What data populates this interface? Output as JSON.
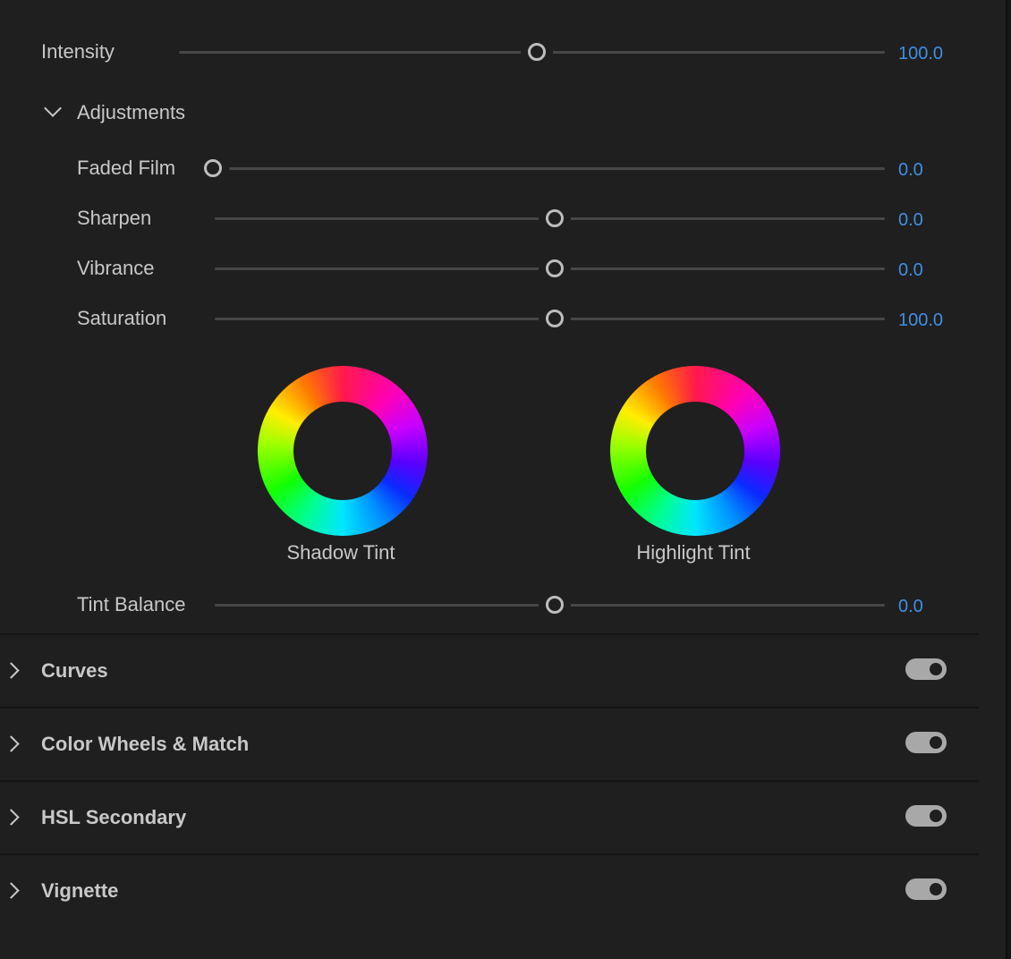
{
  "basic": {
    "intensity": {
      "label": "Intensity",
      "value": "100.0",
      "fraction": 0.5
    }
  },
  "adjustments": {
    "header": "Adjustments",
    "sliders": {
      "faded_film": {
        "label": "Faded Film",
        "value": "0.0",
        "fraction": 0.0
      },
      "sharpen": {
        "label": "Sharpen",
        "value": "0.0",
        "fraction": 0.5
      },
      "vibrance": {
        "label": "Vibrance",
        "value": "0.0",
        "fraction": 0.5
      },
      "saturation": {
        "label": "Saturation",
        "value": "100.0",
        "fraction": 0.5
      },
      "tint_balance": {
        "label": "Tint Balance",
        "value": "0.0",
        "fraction": 0.5
      }
    },
    "wheels": {
      "shadow": {
        "label": "Shadow Tint"
      },
      "highlight": {
        "label": "Highlight Tint"
      }
    }
  },
  "sections": [
    {
      "title": "Curves",
      "enabled": true
    },
    {
      "title": "Color Wheels & Match",
      "enabled": true
    },
    {
      "title": "HSL Secondary",
      "enabled": true
    },
    {
      "title": "Vignette",
      "enabled": true
    }
  ],
  "colors": {
    "background": "#1f1f1f",
    "value_blue": "#3f8fe4",
    "text": "#c8c8c8",
    "track": "#474747",
    "toggle_on": "#a8a8a8"
  }
}
